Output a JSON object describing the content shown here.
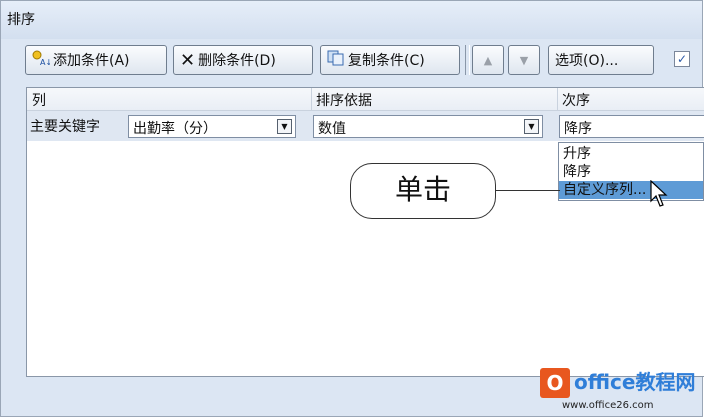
{
  "window": {
    "title": "排序"
  },
  "toolbar": {
    "add_label": "添加条件(A)",
    "delete_label": "删除条件(D)",
    "copy_label": "复制条件(C)",
    "move_up_symbol": "▲",
    "move_down_symbol": "▼",
    "options_label": "选项(O)...",
    "header_checkbox_checked": true,
    "header_checkbox_mark": "✓"
  },
  "grid": {
    "columns": [
      "列",
      "排序依据",
      "次序"
    ],
    "row": {
      "label": "主要关键字",
      "column_value": "出勤率（分）",
      "sort_on_value": "数值",
      "order_value": "降序"
    }
  },
  "order_dropdown": {
    "options": [
      "升序",
      "降序",
      "自定义序列..."
    ],
    "highlighted_index": 2
  },
  "callout": {
    "text": "单击"
  },
  "watermark": {
    "brand": "office教程网",
    "url": "www.office26.com"
  },
  "colors": {
    "dialog_bg": "#dce6f3",
    "selection": "#5e9bd6",
    "watermark_orange": "#e8571f",
    "watermark_blue": "#2f7ed8"
  }
}
